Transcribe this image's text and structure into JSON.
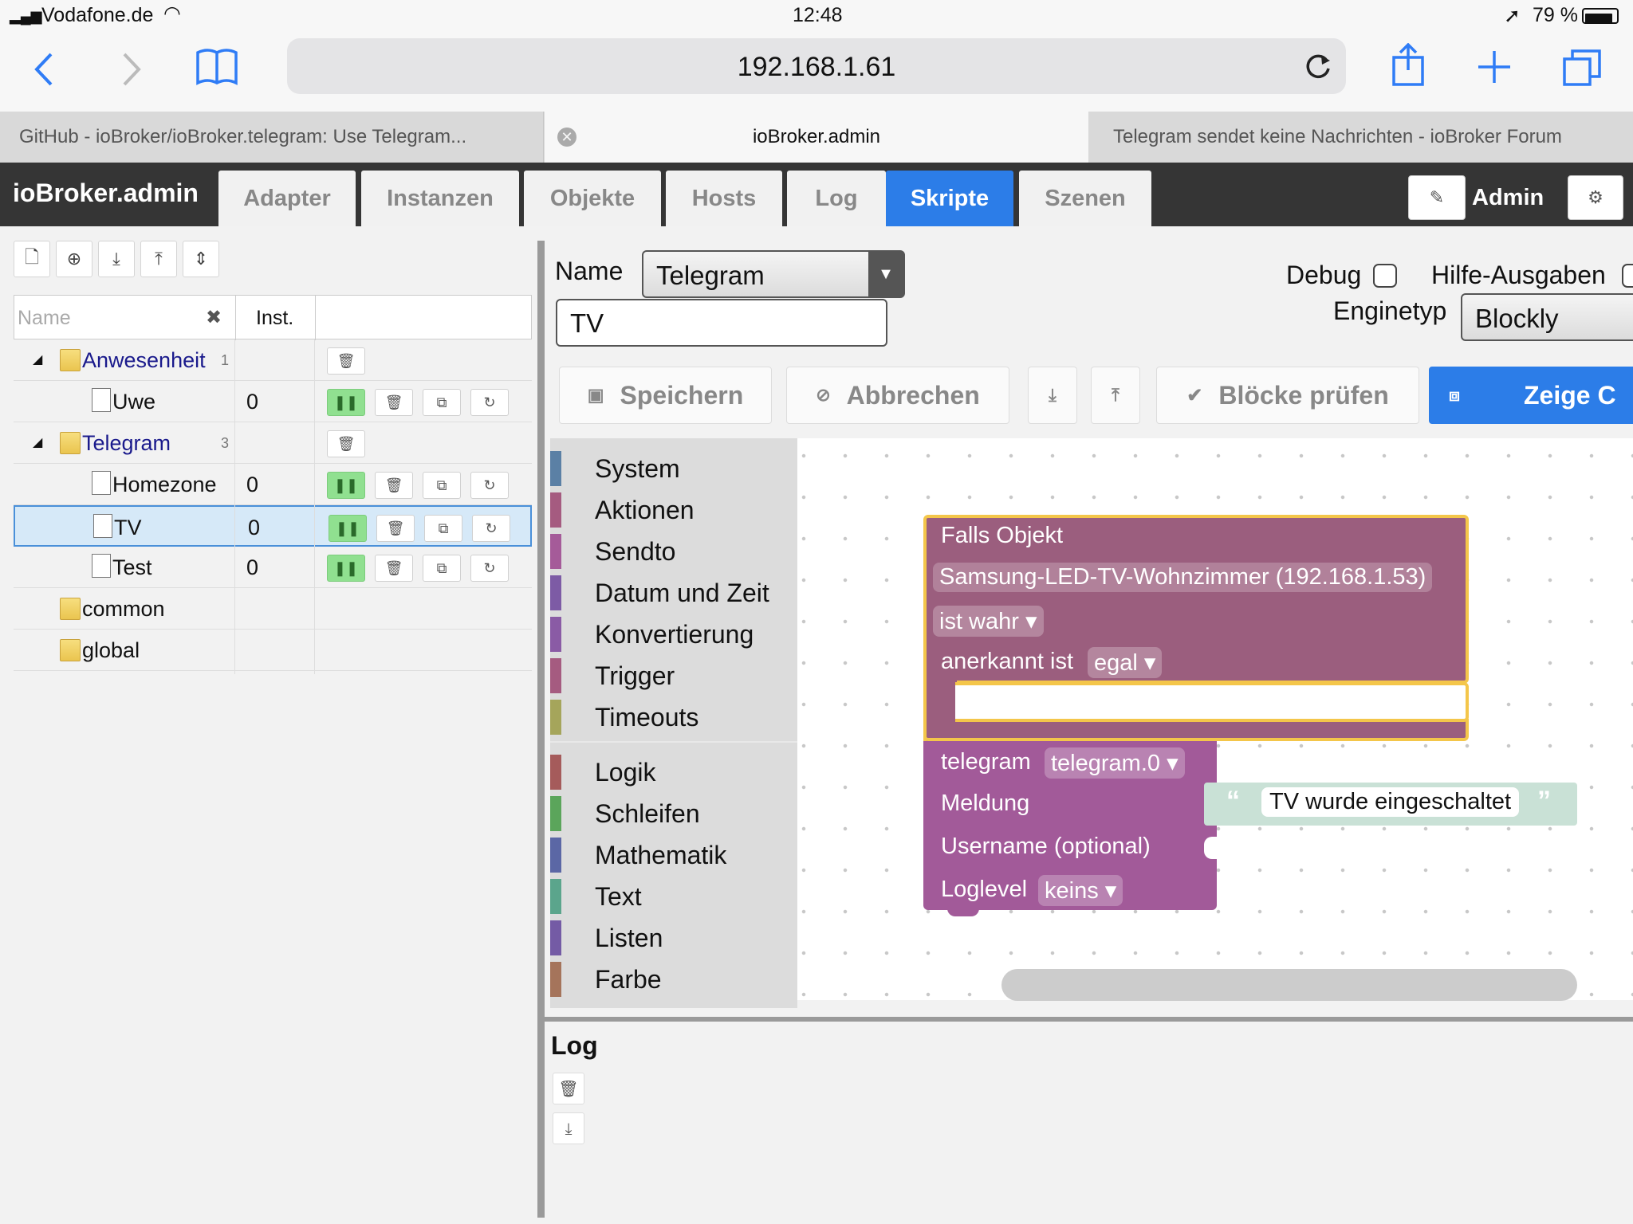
{
  "status_bar": {
    "carrier": "Vodafone.de",
    "time": "12:48",
    "battery": "79 %"
  },
  "browser": {
    "url": "192.168.1.61",
    "tabs": [
      {
        "label": "GitHub - ioBroker/ioBroker.telegram: Use Telegram..."
      },
      {
        "label": "ioBroker.admin",
        "active": true
      },
      {
        "label": "Telegram sendet keine Nachrichten - ioBroker Forum"
      }
    ]
  },
  "app": {
    "title": "ioBroker.admin",
    "nav": [
      {
        "label": "Adapter"
      },
      {
        "label": "Instanzen"
      },
      {
        "label": "Objekte"
      },
      {
        "label": "Hosts"
      },
      {
        "label": "Log"
      },
      {
        "label": "Skripte",
        "active": true
      },
      {
        "label": "Szenen"
      }
    ],
    "user": "Admin"
  },
  "tree": {
    "headers": {
      "name_placeholder": "Name",
      "inst": "Inst."
    },
    "rows": [
      {
        "type": "folder",
        "name": "Anwesenheit",
        "count": "1"
      },
      {
        "type": "script",
        "name": "Uwe",
        "inst": "0"
      },
      {
        "type": "folder",
        "name": "Telegram",
        "count": "3"
      },
      {
        "type": "script",
        "name": "Homezone",
        "inst": "0"
      },
      {
        "type": "script",
        "name": "TV",
        "inst": "0",
        "selected": true
      },
      {
        "type": "script",
        "name": "Test",
        "inst": "0"
      },
      {
        "type": "folder",
        "name": "common"
      },
      {
        "type": "folder",
        "name": "global"
      }
    ]
  },
  "editor": {
    "name_label": "Name",
    "group_value": "Telegram",
    "script_name": "TV",
    "debug_label": "Debug",
    "help_label": "Hilfe-Ausgaben",
    "enginetyp_label": "Enginetyp",
    "engine_value": "Blockly",
    "buttons": {
      "save": "Speichern",
      "cancel": "Abbrechen",
      "check": "Blöcke prüfen",
      "show": "Zeige C"
    }
  },
  "toolbox": [
    {
      "label": "System",
      "color": "#5b80a5"
    },
    {
      "label": "Aktionen",
      "color": "#a55b80"
    },
    {
      "label": "Sendto",
      "color": "#a55b99"
    },
    {
      "label": "Datum und Zeit",
      "color": "#7d5ba5"
    },
    {
      "label": "Konvertierung",
      "color": "#8a5ba5"
    },
    {
      "label": "Trigger",
      "color": "#a55b80"
    },
    {
      "label": "Timeouts",
      "color": "#a5a55b"
    },
    {
      "label": "Logik",
      "color": "#a55b5b"
    },
    {
      "label": "Schleifen",
      "color": "#5ba55b"
    },
    {
      "label": "Mathematik",
      "color": "#5b67a5"
    },
    {
      "label": "Text",
      "color": "#5ba58c"
    },
    {
      "label": "Listen",
      "color": "#745ba5"
    },
    {
      "label": "Farbe",
      "color": "#a5745b"
    }
  ],
  "blocks": {
    "trigger": {
      "header": "Falls Objekt",
      "object": "Samsung-LED-TV-Wohnzimmer (192.168.1.53)",
      "condition": "ist wahr ▾",
      "ack_label": "anerkannt ist",
      "ack_value": "egal ▾"
    },
    "telegram": {
      "label": "telegram",
      "instance": "telegram.0 ▾",
      "message_label": "Meldung",
      "username_label": "Username (optional)",
      "loglevel_label": "Loglevel",
      "loglevel_value": "keins ▾"
    },
    "text": {
      "value": "TV wurde eingeschaltet"
    }
  },
  "log": {
    "title": "Log"
  }
}
